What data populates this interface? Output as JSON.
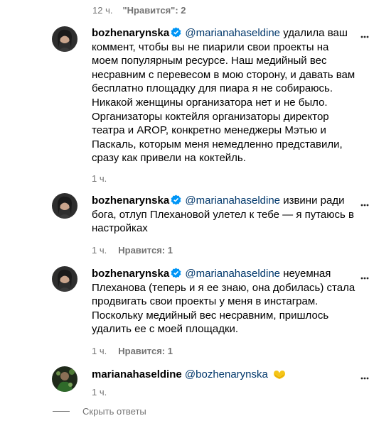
{
  "top": {
    "time": "12 ч.",
    "likes": "\"Нравится\": 2"
  },
  "comments": [
    {
      "username": "bozhenarynska",
      "verified": true,
      "mention": "@marianahaseldine",
      "text": "удалила ваш коммент, чтобы вы не пиарили свои проекты на моем популярным ресурсе. Наш медийный вес несравним с перевесом в мою сторону, и давать вам бесплатно площадку для пиара я не собираюсь. Никакой женщины организатора нет и не было. Организаторы коктейля организаторы директор театра и AROP, конкретно менеджеры Мэтью и Паскаль, которым меня немедленно представили, сразу как привели на коктейль.",
      "time": "1 ч.",
      "likes": ""
    },
    {
      "username": "bozhenarynska",
      "verified": true,
      "mention": "@marianahaseldine",
      "text": "извини ради бога, отлуп Плехановой улетел к тебе — я путаюсь в настройках",
      "time": "1 ч.",
      "likes": "Нравится: 1"
    },
    {
      "username": "bozhenarynska",
      "verified": true,
      "mention": "@marianahaseldine",
      "text": "неуемная Плеханова (теперь и я ее знаю, она добилась) стала продвигать свои проекты у меня в инстаграм. Поскольку медийный вес несравним, пришлось удалить ее с моей площадки.",
      "time": "1 ч.",
      "likes": "Нравится: 1"
    },
    {
      "username": "marianahaseldine",
      "verified": false,
      "mention": "@bozhenarynska",
      "text": "",
      "emoji": "heart-hands-icon",
      "time": "1 ч.",
      "likes": ""
    }
  ],
  "hide_replies": "Скрыть ответы",
  "colors": {
    "mention": "#00376b",
    "meta": "#737373",
    "verified": "#0095f6",
    "heart": "#f5c518"
  }
}
